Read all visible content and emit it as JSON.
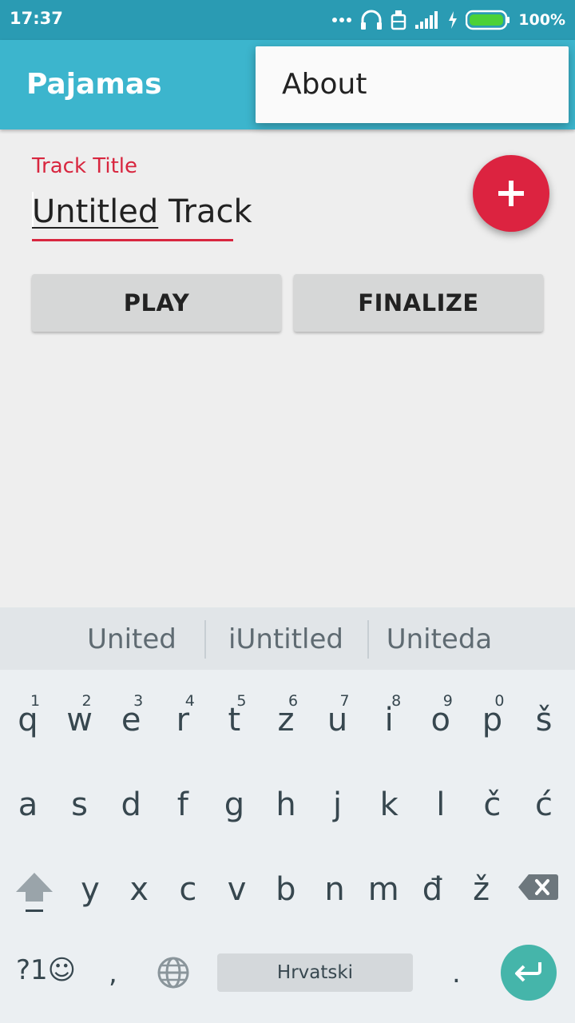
{
  "status_bar": {
    "time": "17:37",
    "battery": "100%",
    "icons": [
      "dots-icon",
      "headphones-icon",
      "alarm-icon",
      "signal-icon",
      "charging-icon",
      "battery-icon"
    ]
  },
  "app_bar": {
    "title": "Pajamas"
  },
  "overflow_menu": {
    "items": [
      {
        "label": "About"
      }
    ]
  },
  "form": {
    "label": "Track Title",
    "value_underlined": "Untitled",
    "value_rest": " Track"
  },
  "fab": {
    "icon": "plus-icon",
    "color": "#dc2340"
  },
  "buttons": {
    "play": "PLAY",
    "finalize": "FINALIZE"
  },
  "keyboard": {
    "suggestions": [
      "United",
      "iUntitled",
      "Uniteda"
    ],
    "row1": [
      {
        "k": "q",
        "n": "1"
      },
      {
        "k": "w",
        "n": "2"
      },
      {
        "k": "e",
        "n": "3"
      },
      {
        "k": "r",
        "n": "4"
      },
      {
        "k": "t",
        "n": "5"
      },
      {
        "k": "z",
        "n": "6"
      },
      {
        "k": "u",
        "n": "7"
      },
      {
        "k": "i",
        "n": "8"
      },
      {
        "k": "o",
        "n": "9"
      },
      {
        "k": "p",
        "n": "0"
      },
      {
        "k": "š",
        "n": ""
      }
    ],
    "row2": [
      "a",
      "s",
      "d",
      "f",
      "g",
      "h",
      "j",
      "k",
      "l",
      "č",
      "ć"
    ],
    "row3": [
      "y",
      "x",
      "c",
      "v",
      "b",
      "n",
      "m",
      "đ",
      "ž"
    ],
    "symbols_label": "?1☺",
    "comma": ",",
    "space_label": "Hrvatski",
    "period": ".",
    "accent_color": "#45b5aa"
  }
}
